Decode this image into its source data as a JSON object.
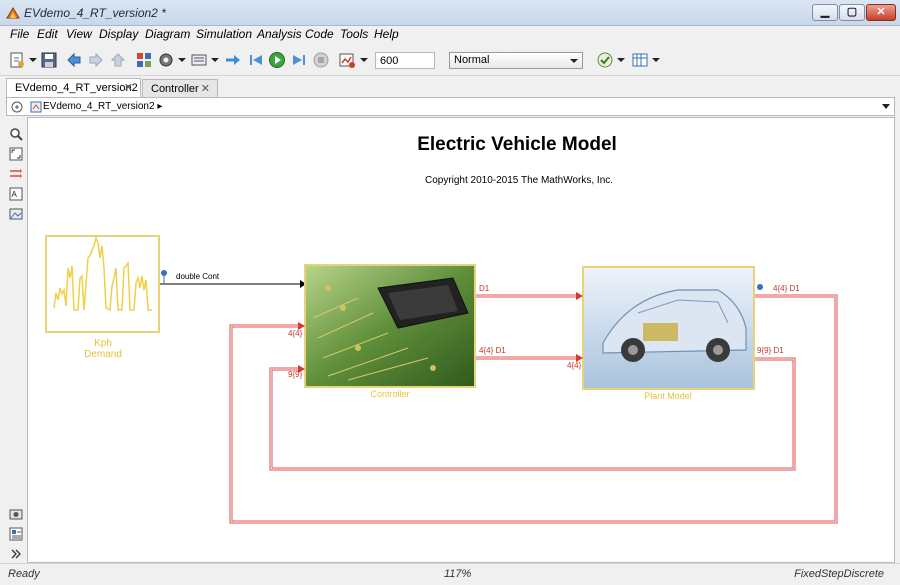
{
  "window": {
    "title": "EVdemo_4_RT_version2 *"
  },
  "menu": [
    "File",
    "Edit",
    "View",
    "Display",
    "Diagram",
    "Simulation",
    "Analysis",
    "Code",
    "Tools",
    "Help"
  ],
  "toolbar": {
    "stop_time": "600",
    "sim_mode": "Normal"
  },
  "tabs": [
    {
      "label": "EVdemo_4_RT_version2",
      "close": "✕"
    },
    {
      "label": "Controller",
      "close": "✕"
    }
  ],
  "breadcrumb": {
    "model": "EVdemo_4_RT_version2"
  },
  "diagram": {
    "title": "Electric Vehicle Model",
    "copyright": "Copyright 2010-2015 The MathWorks, Inc.",
    "demand_label_1": "Kph",
    "demand_label_2": "Demand",
    "signal_label": "double Cont",
    "controller_label": "Controller",
    "plant_label": "Plant Model",
    "ctrl_out_1": "D1",
    "ctrl_out_2": "4{4} D1",
    "ctrl_in_2": "4{4}",
    "ctrl_in_3": "9{9}",
    "plant_in_2": "4{4}",
    "plant_out_1": "4{4} D1",
    "plant_out_2": "9{9} D1"
  },
  "status": {
    "left": "Ready",
    "zoom": "117%",
    "solver": "FixedStepDiscrete"
  }
}
